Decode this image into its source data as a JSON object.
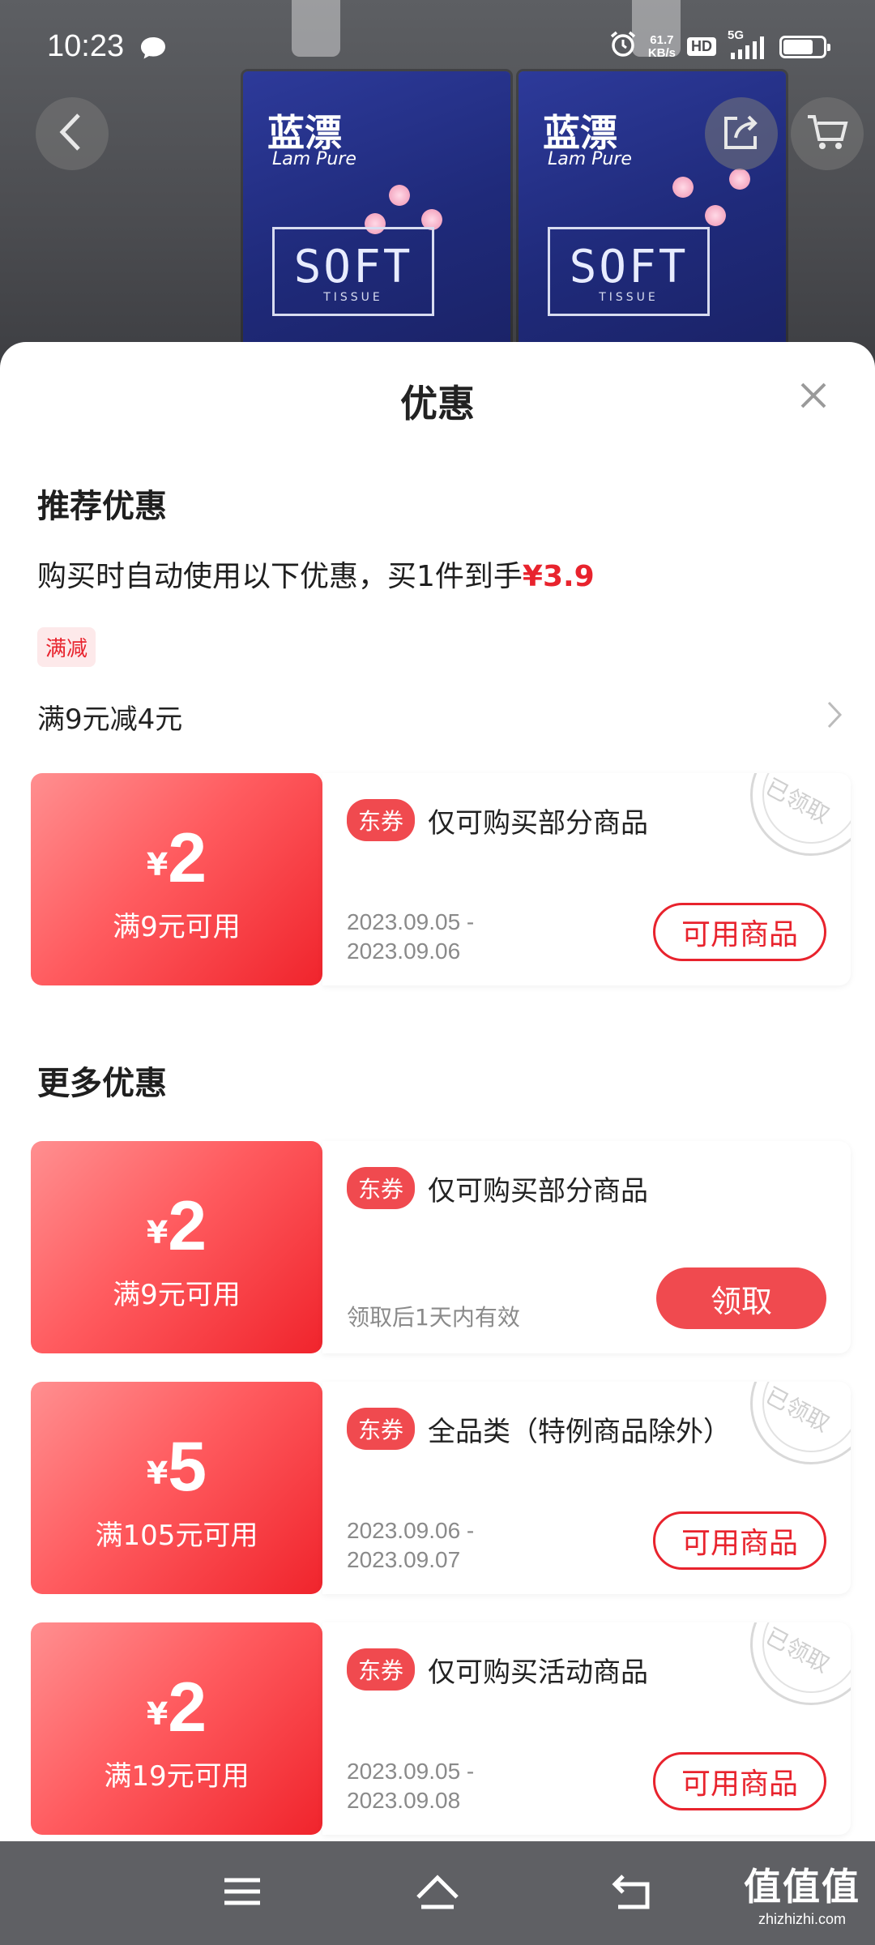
{
  "status_bar": {
    "time": "10:23",
    "net_speed_value": "61.7",
    "net_speed_unit": "KB/s",
    "hd": "HD",
    "signal": "5G",
    "battery_level": 0.7
  },
  "product_image": {
    "brand_cn": "蓝漂",
    "brand_en": "Lam Pure",
    "soft_text": "SOFT",
    "tissue_text": "TISSUE"
  },
  "sheet": {
    "title": "优惠",
    "recommended": {
      "title": "推荐优惠",
      "desc_prefix": "购买时自动使用以下优惠，买1件到手",
      "desc_price": "¥3.9",
      "tag": "满减",
      "rule": "满9元减4元"
    },
    "recommended_coupon": {
      "yen": "¥",
      "amount": "2",
      "condition": "满9元可用",
      "tag": "东券",
      "desc": "仅可购买部分商品",
      "date_start": "2023.09.05 -",
      "date_end": "2023.09.06",
      "button": "可用商品",
      "stamp": "已领取"
    },
    "more": {
      "title": "更多优惠",
      "coupons": [
        {
          "yen": "¥",
          "amount": "2",
          "condition": "满9元可用",
          "tag": "东券",
          "desc": "仅可购买部分商品",
          "validity": "领取后1天内有效",
          "button": "领取"
        },
        {
          "yen": "¥",
          "amount": "5",
          "condition": "满105元可用",
          "tag": "东券",
          "desc": "全品类（特例商品除外）",
          "date_start": "2023.09.06 -",
          "date_end": "2023.09.07",
          "button": "可用商品",
          "stamp": "已领取"
        },
        {
          "yen": "¥",
          "amount": "2",
          "condition": "满19元可用",
          "tag": "东券",
          "desc": "仅可购买活动商品",
          "date_start": "2023.09.05 -",
          "date_end": "2023.09.08",
          "button": "可用商品",
          "stamp": "已领取"
        }
      ]
    }
  },
  "watermark": {
    "big": "值值值",
    "small": "zhizhizhi.com"
  },
  "colors": {
    "accent_red": "#e8232d",
    "coupon_red": "#f04a4f"
  }
}
